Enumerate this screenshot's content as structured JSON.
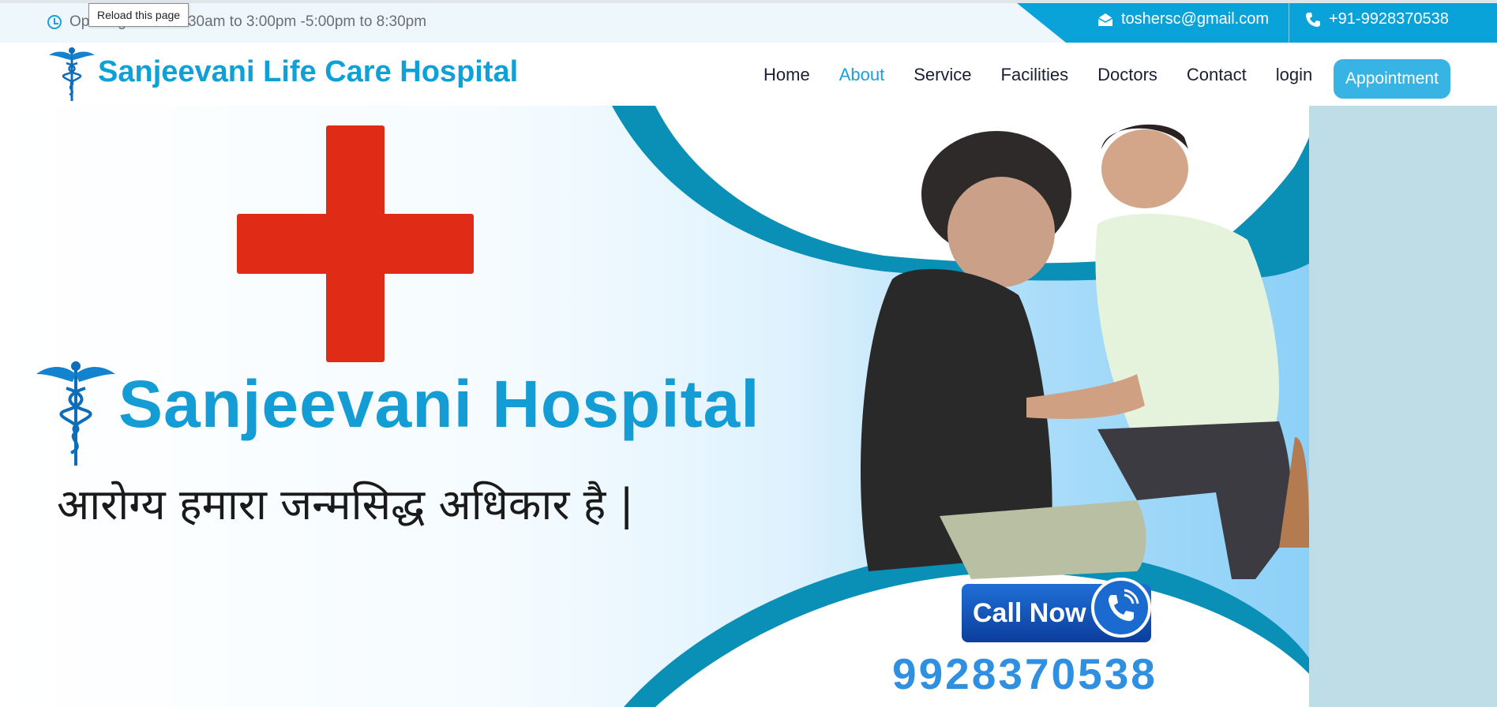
{
  "browser": {
    "tooltip": "Reload this page"
  },
  "topbar": {
    "hours_text": "Opening Time:10:30am to 3:00pm -5:00pm to 8:30pm",
    "email": "toshersc@gmail.com",
    "phone": "+91-9928370538",
    "clock_icon": "clock-icon",
    "email_icon": "envelope-icon",
    "phone_icon": "phone-icon"
  },
  "header": {
    "brand": "Sanjeevani Life Care Hospital",
    "nav": [
      {
        "label": "Home",
        "active": false
      },
      {
        "label": "About",
        "active": true
      },
      {
        "label": "Service",
        "active": false
      },
      {
        "label": "Facilities",
        "active": false
      },
      {
        "label": "Doctors",
        "active": false
      },
      {
        "label": "Contact",
        "active": false
      },
      {
        "label": "login",
        "active": false
      }
    ],
    "appointment_label": "Appointment"
  },
  "hero": {
    "title": "Sanjeevani Hospital",
    "tagline": "आरोग्य हमारा जन्मसिद्ध अधिकार है |",
    "call_label": "Call Now",
    "phone_number": "9928370538"
  },
  "colors": {
    "brand": "#0ea1d8",
    "cross": "#e02c17",
    "topbar_accent": "#0aa3d9",
    "button": "#38b4e4"
  }
}
